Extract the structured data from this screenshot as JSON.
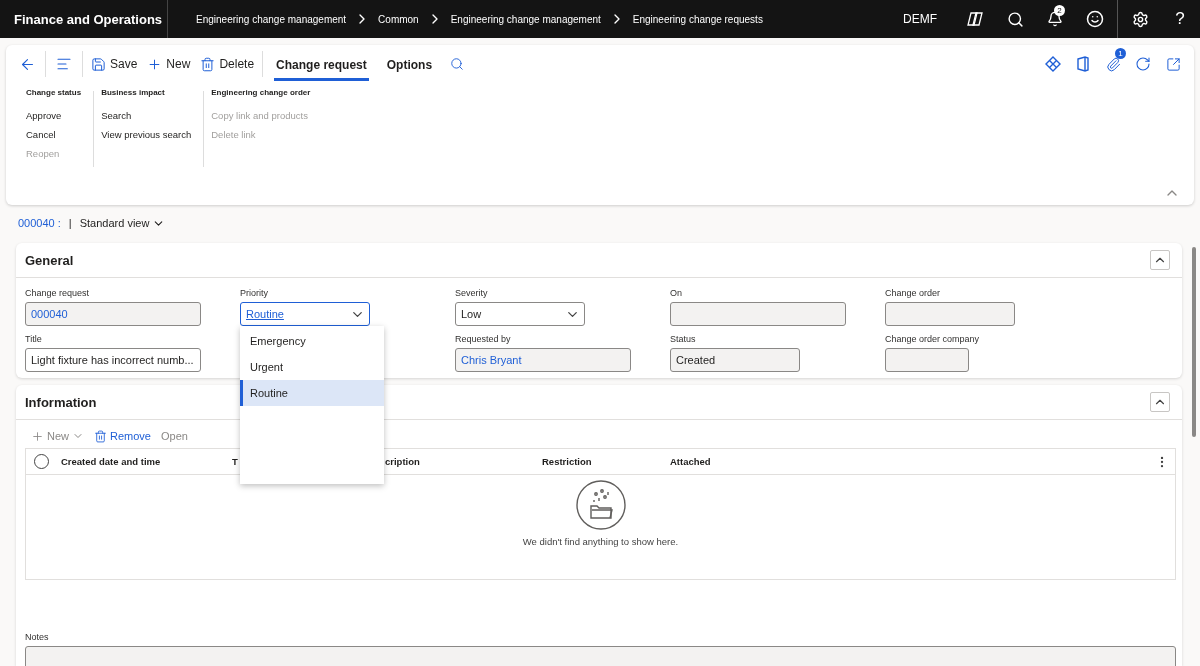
{
  "app_bar": {
    "title": "Finance and Operations",
    "breadcrumbs": [
      "Engineering change management",
      "Common",
      "Engineering change management",
      "Engineering change requests"
    ],
    "company": "DEMF",
    "notification_count": "2",
    "help": "?"
  },
  "action_pane": {
    "buttons": [
      {
        "label": "Save",
        "kind": "save"
      },
      {
        "label": "New",
        "kind": "new"
      },
      {
        "label": "Delete",
        "kind": "delete"
      }
    ],
    "tabs": [
      {
        "label": "Change request",
        "selected": true
      },
      {
        "label": "Options",
        "selected": false
      }
    ],
    "attachment_count": "1",
    "groups": [
      {
        "title": "Change status",
        "items": [
          {
            "label": "Approve",
            "disabled": false
          },
          {
            "label": "Cancel",
            "disabled": false
          },
          {
            "label": "Reopen",
            "disabled": true
          }
        ]
      },
      {
        "title": "Business impact",
        "items": [
          {
            "label": "Search",
            "disabled": false
          },
          {
            "label": "View previous search",
            "disabled": false
          }
        ]
      },
      {
        "title": "Engineering change order",
        "items": [
          {
            "label": "Copy link and products",
            "disabled": true
          },
          {
            "label": "Delete link",
            "disabled": true
          }
        ]
      }
    ]
  },
  "record": {
    "id": "000040 :",
    "separator": "|",
    "view": "Standard view"
  },
  "general": {
    "title": "General",
    "rows": [
      [
        {
          "label": "Change request",
          "value": "000040",
          "kind": "readonly",
          "link": true
        },
        {
          "label": "Priority",
          "value": "Routine",
          "kind": "dropdown",
          "link": true,
          "expanded": true,
          "options": [
            {
              "label": "Emergency",
              "selected": false
            },
            {
              "label": "Urgent",
              "selected": false
            },
            {
              "label": "Routine",
              "selected": true
            }
          ]
        },
        {
          "label": "Severity",
          "value": "Low",
          "kind": "dropdown",
          "link": false,
          "expanded": false
        },
        {
          "label": "On",
          "kind": "readonly"
        },
        {
          "label": "Change order",
          "kind": "readonly"
        }
      ],
      [
        {
          "label": "Title",
          "value": "Light fixture has incorrect numb...",
          "kind": "input",
          "link": false
        },
        null,
        {
          "label": "Requested by",
          "value": "Chris Bryant",
          "kind": "readonly",
          "link": true
        },
        {
          "label": "Status",
          "value": "Created",
          "kind": "readonly",
          "link": false
        },
        {
          "label": "Change order company",
          "kind": "readonly"
        }
      ]
    ]
  },
  "information": {
    "title": "Information",
    "toolbar": [
      {
        "label": "New",
        "kind": "new",
        "disabled": true
      },
      {
        "label": "Remove",
        "kind": "remove",
        "disabled": false
      },
      {
        "label": "Open",
        "kind": "open",
        "disabled": true
      }
    ],
    "select_all": {
      "checked": false
    },
    "columns": [
      "Created date and time",
      "T",
      "cription",
      "Restriction",
      "Attached"
    ],
    "empty_message": "We didn't find anything to show here.",
    "notes_label": "Notes"
  }
}
